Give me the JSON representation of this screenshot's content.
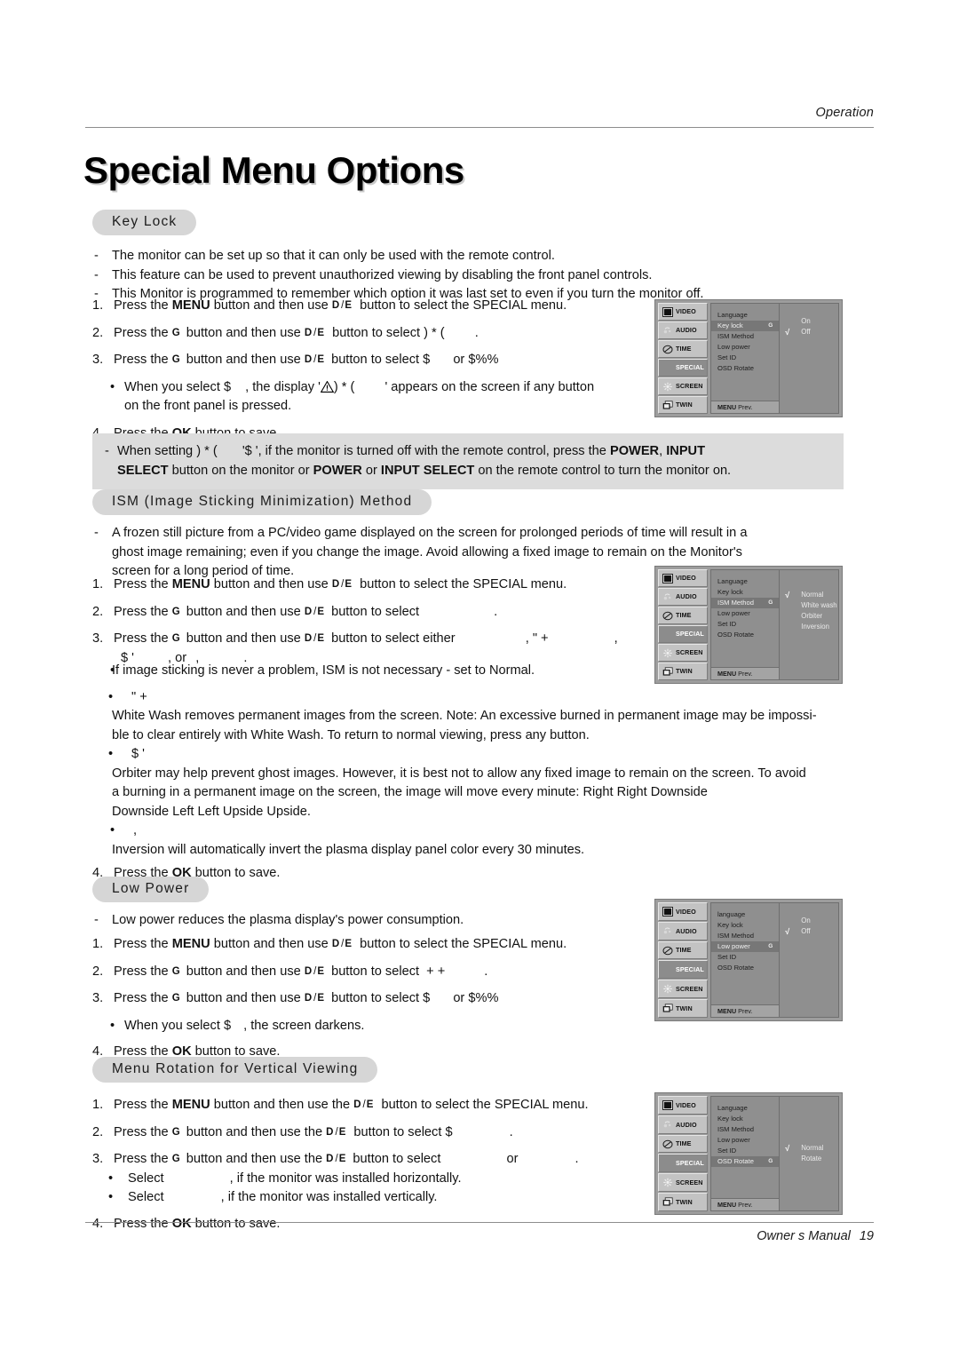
{
  "header": {
    "running_head": "Operation"
  },
  "title": "Special Menu Options",
  "footer": {
    "manual_label": "Owner s Manual",
    "page_number": "19"
  },
  "sections": {
    "key_lock": {
      "heading": "Key Lock",
      "dashes": [
        "The monitor can be set up so that it can only be used with the remote control.",
        "This feature can be used to prevent unauthorized viewing by disabling the front panel controls.",
        "This Monitor is programmed to remember which option it was last set to even if you turn the monitor off."
      ],
      "steps": {
        "n1": "1.",
        "n1_a": "Press the",
        "n1_menu": "MENU",
        "n1_b": "button and then use",
        "n1_c": "button to select the SPECIAL menu.",
        "n2": "2.",
        "n2_a": "Press the",
        "n2_g": "G",
        "n2_b": "button and then use",
        "n2_c": "button to select",
        "n2_target": ") *     (",
        "n2_end": ".",
        "n3": "3.",
        "n3_a": "Press the",
        "n3_g": "G",
        "n3_b": "button and then use",
        "n3_c": "button to select",
        "n3_opt1": "$",
        "n3_or": "or",
        "n3_opt2": "$%%",
        "bullet": "•",
        "bullet_a": "When you select",
        "bullet_opt": "$",
        "bullet_b": ", the display '",
        "bullet_target": ") *     (",
        "bullet_c": "' appears on the screen if any button",
        "bullet_line2": "on the front panel is pressed.",
        "n4": "4.",
        "n4_a": "Press the",
        "n4_ok": "OK",
        "n4_b": "button to save."
      },
      "note": {
        "dash": "-",
        "a": "When setting",
        "target": ") *     (",
        "b": "'$   ', if the monitor is turned off with the remote control, press the",
        "power": "POWER",
        "comma": ",",
        "input": "INPUT",
        "select": "SELECT",
        "c": "button on the monitor or",
        "power2": "POWER",
        "or": "or",
        "input_select": "INPUT SELECT",
        "d": "on the remote control to turn the monitor on."
      }
    },
    "ism": {
      "heading": "ISM (Image Sticking Minimization) Method",
      "dash_para": [
        "A frozen still picture from a PC/video game displayed on the screen for prolonged periods of time will result in a",
        "ghost image remaining; even if you change the image. Avoid allowing a fixed image to remain on the Monitor's",
        "screen for a long period of time."
      ],
      "steps": {
        "n1": "1.",
        "n1_a": "Press the",
        "n1_menu": "MENU",
        "n1_b": "button and then use",
        "n1_c": "button to select the SPECIAL menu.",
        "n2": "2.",
        "n2_a": "Press the",
        "n2_g": "G",
        "n2_b": "button and then use",
        "n2_c": "button to select",
        "n2_end": ".",
        "n3": "3.",
        "n3_a": "Press the",
        "n3_g": "G",
        "n3_b": "button and then use",
        "n3_c": "button to select either",
        "n3_opt1": ",",
        "n3_opt2": "\"    +",
        "n3_opt3": ",",
        "n3_line2_a": "$ '",
        "n3_line2_or": ", or",
        "n3_line2_b": ",",
        "n3_line2_end": ".",
        "n4": "4.",
        "n4_a": "Press the",
        "n4_ok": "OK",
        "n4_b": "button to save."
      },
      "bullets": [
        {
          "marker": "•",
          "title": "",
          "text": "If image sticking is never a problem, ISM is not necessary - set to Normal."
        },
        {
          "marker": "•",
          "title": "\"    +",
          "text": "White Wash removes permanent images from the screen. Note: An excessive burned in permanent image may be impossi-"
        },
        {
          "marker": "",
          "title": "",
          "text": "ble to clear entirely with White Wash. To return to normal viewing, press any button."
        },
        {
          "marker": "•",
          "title": "$ '",
          "text": ""
        },
        {
          "marker": "",
          "title": "",
          "text": "Orbiter may help prevent ghost images. However, it is best not to allow any fixed image to remain on the screen. To avoid"
        },
        {
          "marker": "",
          "title": "",
          "text": "a burning in a permanent image on the screen, the image will move every minute: Right      Right      Downside"
        },
        {
          "marker": "",
          "title": "",
          "text": "Downside      Left      Left      Upside      Upside."
        },
        {
          "marker": "•",
          "title": ",",
          "text": ""
        },
        {
          "marker": "",
          "title": "",
          "text": "Inversion will automatically invert the plasma display panel color every 30 minutes."
        }
      ]
    },
    "low_power": {
      "heading": "Low Power",
      "dashes": [
        "Low power reduces the plasma display's power consumption."
      ],
      "steps": {
        "n1": "1.",
        "n1_a": "Press the",
        "n1_menu": "MENU",
        "n1_b": "button and then use",
        "n1_c": "button to select the SPECIAL menu.",
        "n2": "2.",
        "n2_a": "Press the",
        "n2_g": "G",
        "n2_b": "button and then use",
        "n2_c": "button to select",
        "n2_target": "+  +",
        "n2_end": ".",
        "n3": "3.",
        "n3_a": "Press the",
        "n3_g": "G",
        "n3_b": "button and then use",
        "n3_c": "button to select",
        "n3_opt1": "$",
        "n3_or": "or",
        "n3_opt2": "$%%",
        "bullet": "•",
        "bullet_a": "When you select",
        "bullet_opt": "$",
        "bullet_b": ", the screen darkens.",
        "n4": "4.",
        "n4_a": "Press the",
        "n4_ok": "OK",
        "n4_b": "button to save."
      }
    },
    "menu_rotation": {
      "heading": "Menu Rotation for Vertical Viewing",
      "steps": {
        "n1": "1.",
        "n1_a": "Press the",
        "n1_menu": "MENU",
        "n1_b": "button and then use the",
        "n1_c": "button to select the SPECIAL menu.",
        "n2": "2.",
        "n2_a": "Press the",
        "n2_g": "G",
        "n2_b": "button and then use the",
        "n2_c": "button to select",
        "n2_target": "$",
        "n2_end": ".",
        "n3": "3.",
        "n3_a": "Press the",
        "n3_g": "G",
        "n3_b": "button and then use the",
        "n3_c": "button to select",
        "n3_or": "or",
        "n3_end": ".",
        "b1": "•",
        "b1_a": "Select",
        "b1_b": ", if the monitor was installed horizontally.",
        "b2": "•",
        "b2_a": "Select",
        "b2_b": ", if the monitor was installed vertically.",
        "n4": "4.",
        "n4_a": "Press the",
        "n4_ok": "OK",
        "n4_b": "button to save."
      }
    }
  },
  "osd_nav": [
    {
      "label": "VIDEO",
      "icon": "video-icon"
    },
    {
      "label": "AUDIO",
      "icon": "audio-icon"
    },
    {
      "label": "TIME",
      "icon": "time-icon"
    },
    {
      "label": "SPECIAL",
      "icon": "special-icon"
    },
    {
      "label": "SCREEN",
      "icon": "screen-icon"
    },
    {
      "label": "TWIN",
      "icon": "twin-icon"
    }
  ],
  "osd_footer": {
    "menu": "MENU",
    "prev": "Prev."
  },
  "osd_panels": {
    "key_lock": {
      "items": [
        {
          "label": "Language",
          "selected": false,
          "marker": ""
        },
        {
          "label": "Key lock",
          "selected": true,
          "marker": "G"
        },
        {
          "label": "ISM Method",
          "selected": false,
          "marker": ""
        },
        {
          "label": "Low power",
          "selected": false,
          "marker": ""
        },
        {
          "label": "Set ID",
          "selected": false,
          "marker": ""
        },
        {
          "label": "OSD Rotate",
          "selected": false,
          "marker": ""
        }
      ],
      "options": [
        {
          "label": "On",
          "checked": false
        },
        {
          "label": "Off",
          "checked": true
        }
      ]
    },
    "ism": {
      "items": [
        {
          "label": "Language",
          "selected": false,
          "marker": ""
        },
        {
          "label": "Key lock",
          "selected": false,
          "marker": ""
        },
        {
          "label": "ISM Method",
          "selected": true,
          "marker": "G"
        },
        {
          "label": "Low power",
          "selected": false,
          "marker": ""
        },
        {
          "label": "Set ID",
          "selected": false,
          "marker": ""
        },
        {
          "label": "OSD Rotate",
          "selected": false,
          "marker": ""
        }
      ],
      "options": [
        {
          "label": "Normal",
          "checked": true
        },
        {
          "label": "White wash",
          "checked": false
        },
        {
          "label": "Orbiter",
          "checked": false
        },
        {
          "label": "Inversion",
          "checked": false
        }
      ]
    },
    "low_power": {
      "items": [
        {
          "label": "language",
          "selected": false,
          "marker": ""
        },
        {
          "label": "Key lock",
          "selected": false,
          "marker": ""
        },
        {
          "label": "ISM Method",
          "selected": false,
          "marker": ""
        },
        {
          "label": "Low power",
          "selected": true,
          "marker": "G"
        },
        {
          "label": "Set ID",
          "selected": false,
          "marker": ""
        },
        {
          "label": "OSD Rotate",
          "selected": false,
          "marker": ""
        }
      ],
      "options": [
        {
          "label": "On",
          "checked": false
        },
        {
          "label": "Off",
          "checked": true
        }
      ]
    },
    "osd_rotate": {
      "items": [
        {
          "label": "Language",
          "selected": false,
          "marker": ""
        },
        {
          "label": "Key lock",
          "selected": false,
          "marker": ""
        },
        {
          "label": "ISM Method",
          "selected": false,
          "marker": ""
        },
        {
          "label": "Low power",
          "selected": false,
          "marker": ""
        },
        {
          "label": "Set ID",
          "selected": false,
          "marker": ""
        },
        {
          "label": "OSD Rotate",
          "selected": true,
          "marker": "G"
        }
      ],
      "options": [
        {
          "label": "Normal",
          "checked": true
        },
        {
          "label": "Rotate",
          "checked": false
        }
      ]
    }
  },
  "colors": {
    "pill_bg": "#d6d6d6",
    "note_bg": "#dcdcdc",
    "osd_bg": "#9d9d9d",
    "osd_panel": "#8f8f8f",
    "osd_nav": "#c3c3c3",
    "osd_active": "#8c8c8c"
  }
}
